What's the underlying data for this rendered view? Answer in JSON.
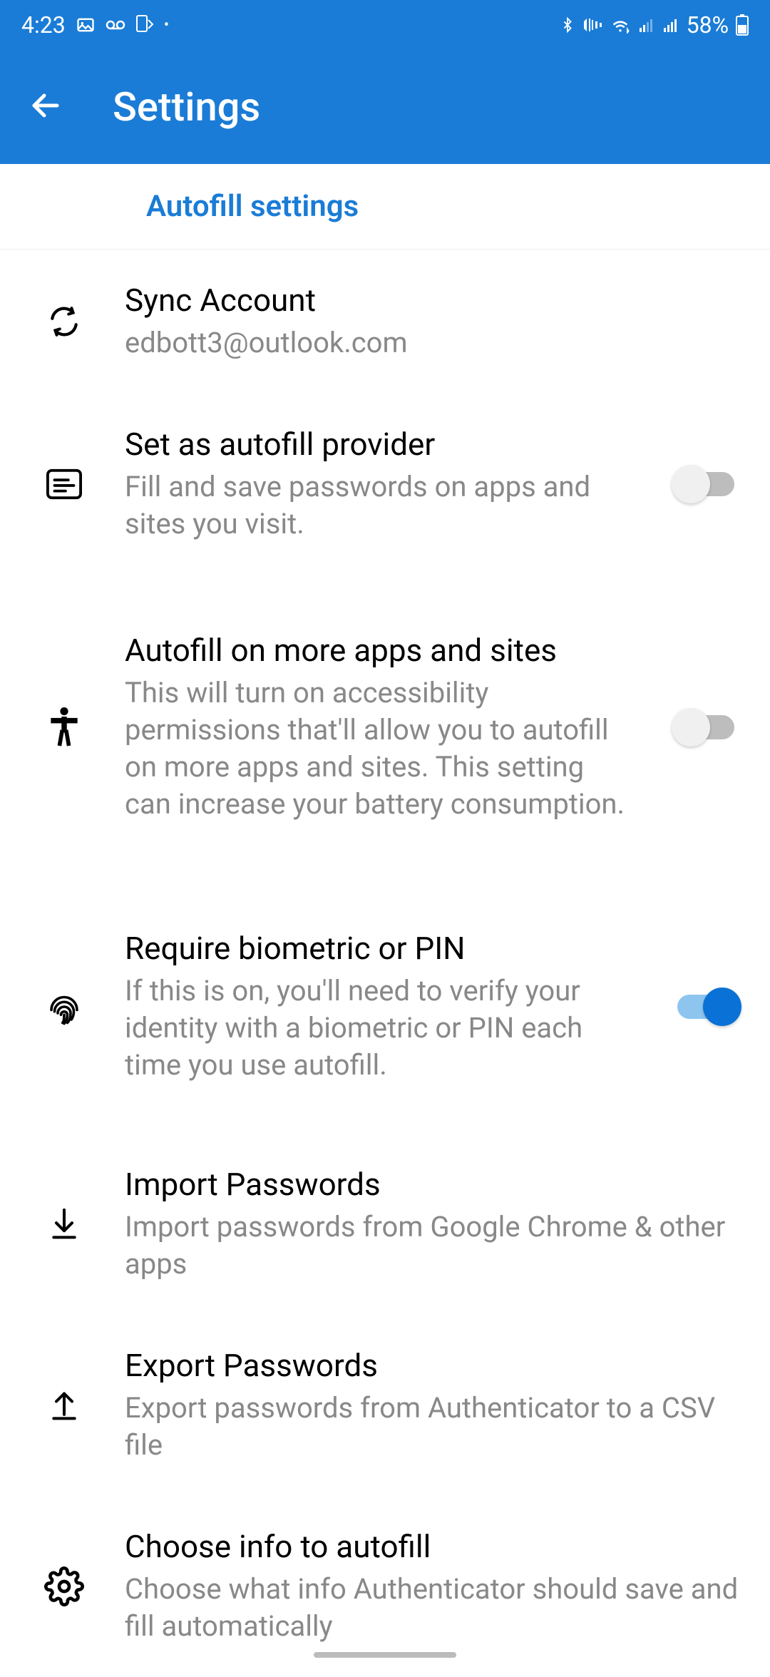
{
  "status_bar": {
    "time": "4:23",
    "battery_pct": "58%"
  },
  "app_bar": {
    "title": "Settings"
  },
  "section_header": "Autofill settings",
  "items": {
    "sync": {
      "title": "Sync Account",
      "desc": "edbott3@outlook.com"
    },
    "autofill_provider": {
      "title": "Set as autofill provider",
      "desc": "Fill and save passwords on apps and sites you visit.",
      "toggle": false
    },
    "more_apps": {
      "title": "Autofill on more apps and sites",
      "desc": "This will turn on accessibility permissions that'll allow you to autofill on more apps and sites. This setting can increase your battery consumption.",
      "toggle": false
    },
    "biometric": {
      "title": "Require biometric or PIN",
      "desc": "If this is on, you'll need to verify your identity with a biometric or PIN each time you use autofill.",
      "toggle": true
    },
    "import": {
      "title": "Import Passwords",
      "desc": "Import passwords from Google Chrome & other apps"
    },
    "export": {
      "title": "Export Passwords",
      "desc": "Export passwords from Authenticator to a CSV file"
    },
    "choose": {
      "title": "Choose info to autofill",
      "desc": "Choose what info Authenticator should save and fill automatically"
    }
  }
}
